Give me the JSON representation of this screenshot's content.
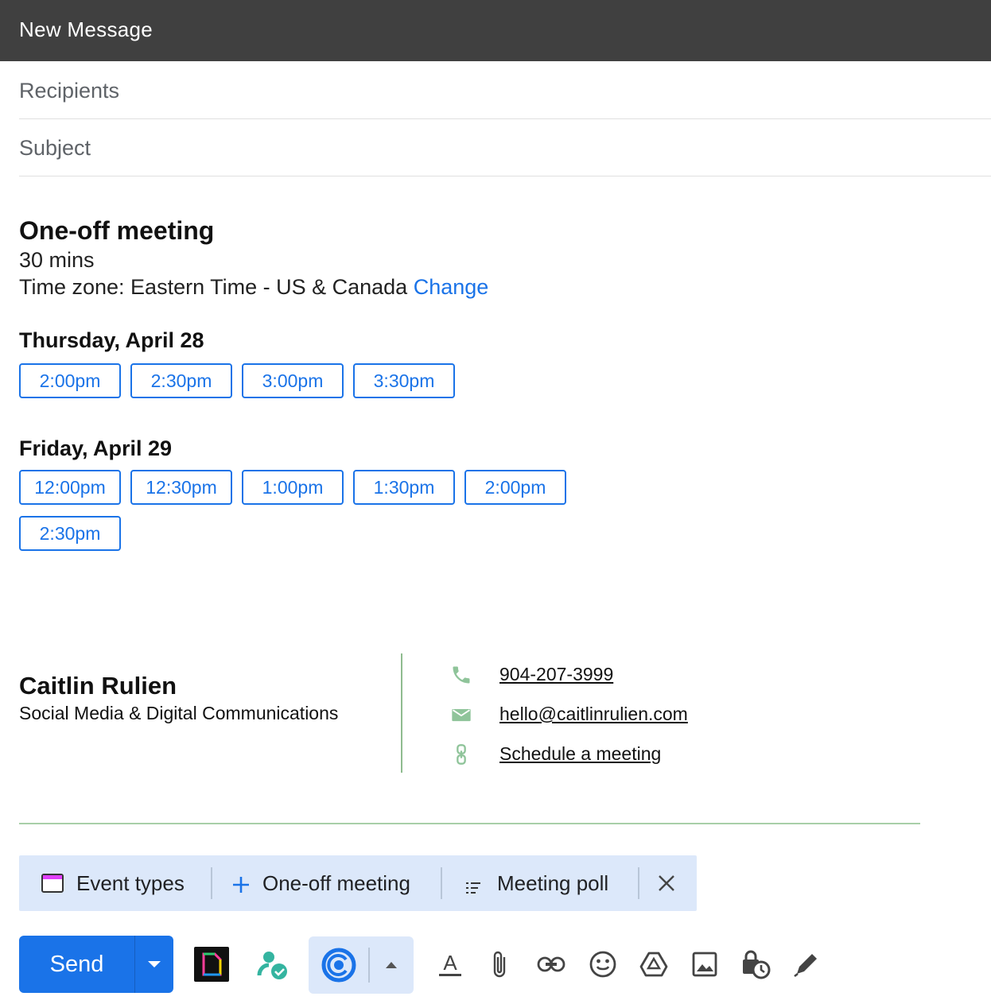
{
  "window": {
    "title": "New Message"
  },
  "fields": {
    "recipients_placeholder": "Recipients",
    "subject_placeholder": "Subject"
  },
  "meeting": {
    "title": "One-off meeting",
    "duration": "30 mins",
    "timezone_text": "Time zone: Eastern Time - US & Canada",
    "change_label": "Change",
    "days": [
      {
        "label": "Thursday, April 28",
        "slots": [
          "2:00pm",
          "2:30pm",
          "3:00pm",
          "3:30pm"
        ]
      },
      {
        "label": "Friday, April 29",
        "slots": [
          "12:00pm",
          "12:30pm",
          "1:00pm",
          "1:30pm",
          "2:00pm",
          "2:30pm"
        ]
      }
    ]
  },
  "signature": {
    "name": "Caitlin Rulien",
    "role": "Social Media & Digital Communications",
    "phone": "904-207-3999",
    "email": "hello@caitlinrulien.com",
    "schedule_label": "Schedule a meeting",
    "accent_color": "#8fbc8f"
  },
  "calendly_bar": {
    "event_types_label": "Event types",
    "one_off_label": "One-off meeting",
    "poll_label": "Meeting poll",
    "close_icon": "close-icon"
  },
  "toolbar": {
    "send_label": "Send",
    "icons": [
      "send-options-icon",
      "app-extension-icon",
      "contact-check-icon",
      "calendly-icon",
      "expand-up-icon",
      "formatting-icon",
      "attach-icon",
      "link-icon",
      "emoji-icon",
      "drive-icon",
      "photo-icon",
      "confidential-mode-icon",
      "signature-icon"
    ]
  },
  "colors": {
    "accent": "#1a73e8",
    "header": "#404040",
    "calendly_bg": "#dce8fa"
  }
}
